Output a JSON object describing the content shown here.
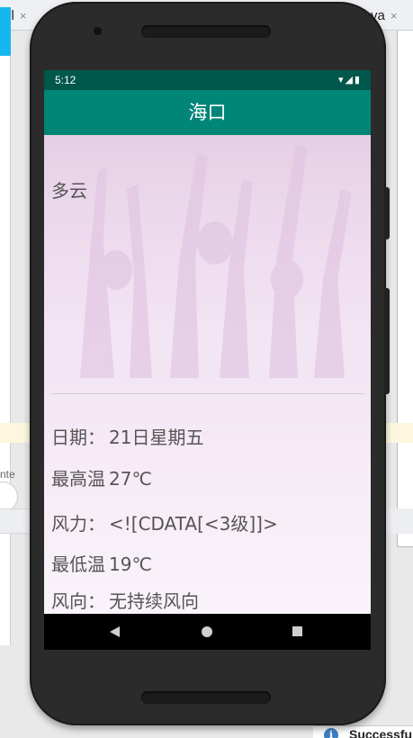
{
  "ide": {
    "tabs": [
      {
        "label": "ml",
        "close": "×"
      },
      {
        "label": "va",
        "close": "×"
      }
    ],
    "left_text": "nte",
    "toast": {
      "icon": "i",
      "message": "Successfu"
    }
  },
  "device": {
    "status_bar": {
      "time": "5:12",
      "icons": "▾◢▮"
    },
    "app_bar": {
      "title": "海口"
    },
    "weather": {
      "condition": "多云"
    },
    "details": [
      {
        "label": "日期：",
        "value": "21日星期五"
      },
      {
        "label": "最高温",
        "value": "27℃"
      },
      {
        "label": "风力：",
        "value": "<![CDATA[<3级]]>"
      },
      {
        "label": "最低温",
        "value": "19℃"
      },
      {
        "label": "风向：",
        "value": "无持续风向"
      }
    ]
  },
  "colors": {
    "status_bar": "#00574b",
    "app_bar": "#008577",
    "content_tint": "#f3e6f4"
  }
}
